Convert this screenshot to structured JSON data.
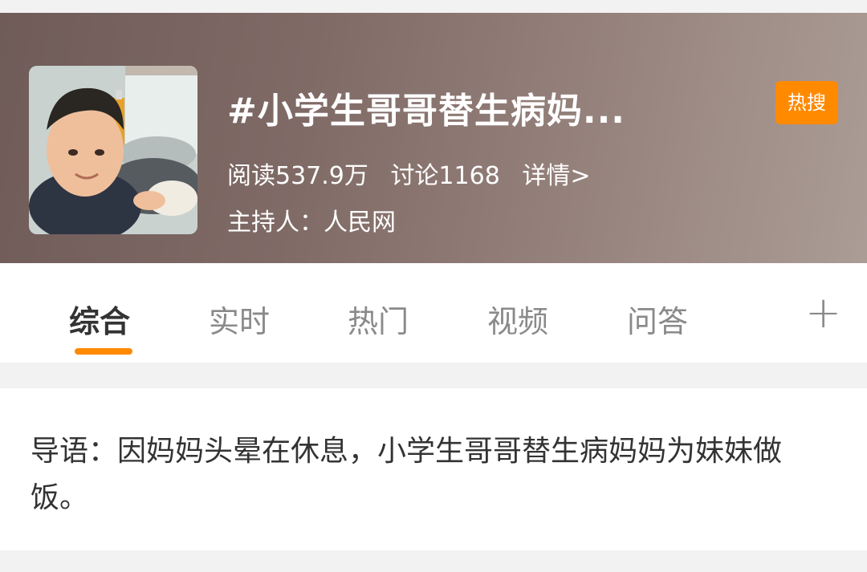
{
  "header": {
    "title": "#小学生哥哥替生病妈...",
    "badge": "热搜",
    "reads": "阅读537.9万",
    "discussions": "讨论1168",
    "details_link": "详情>",
    "host": "主持人：人民网"
  },
  "tabs": [
    {
      "label": "综合",
      "active": true
    },
    {
      "label": "实时",
      "active": false
    },
    {
      "label": "热门",
      "active": false
    },
    {
      "label": "视频",
      "active": false
    },
    {
      "label": "问答",
      "active": false
    }
  ],
  "add_tab_label": "+",
  "intro": {
    "text": "导语：因妈妈头晕在休息，小学生哥哥替生病妈妈为妹妹做饭。"
  },
  "colors": {
    "accent": "#ff8a00",
    "header_bg": "#7f6a66"
  },
  "icons": {
    "add": "plus-icon"
  }
}
